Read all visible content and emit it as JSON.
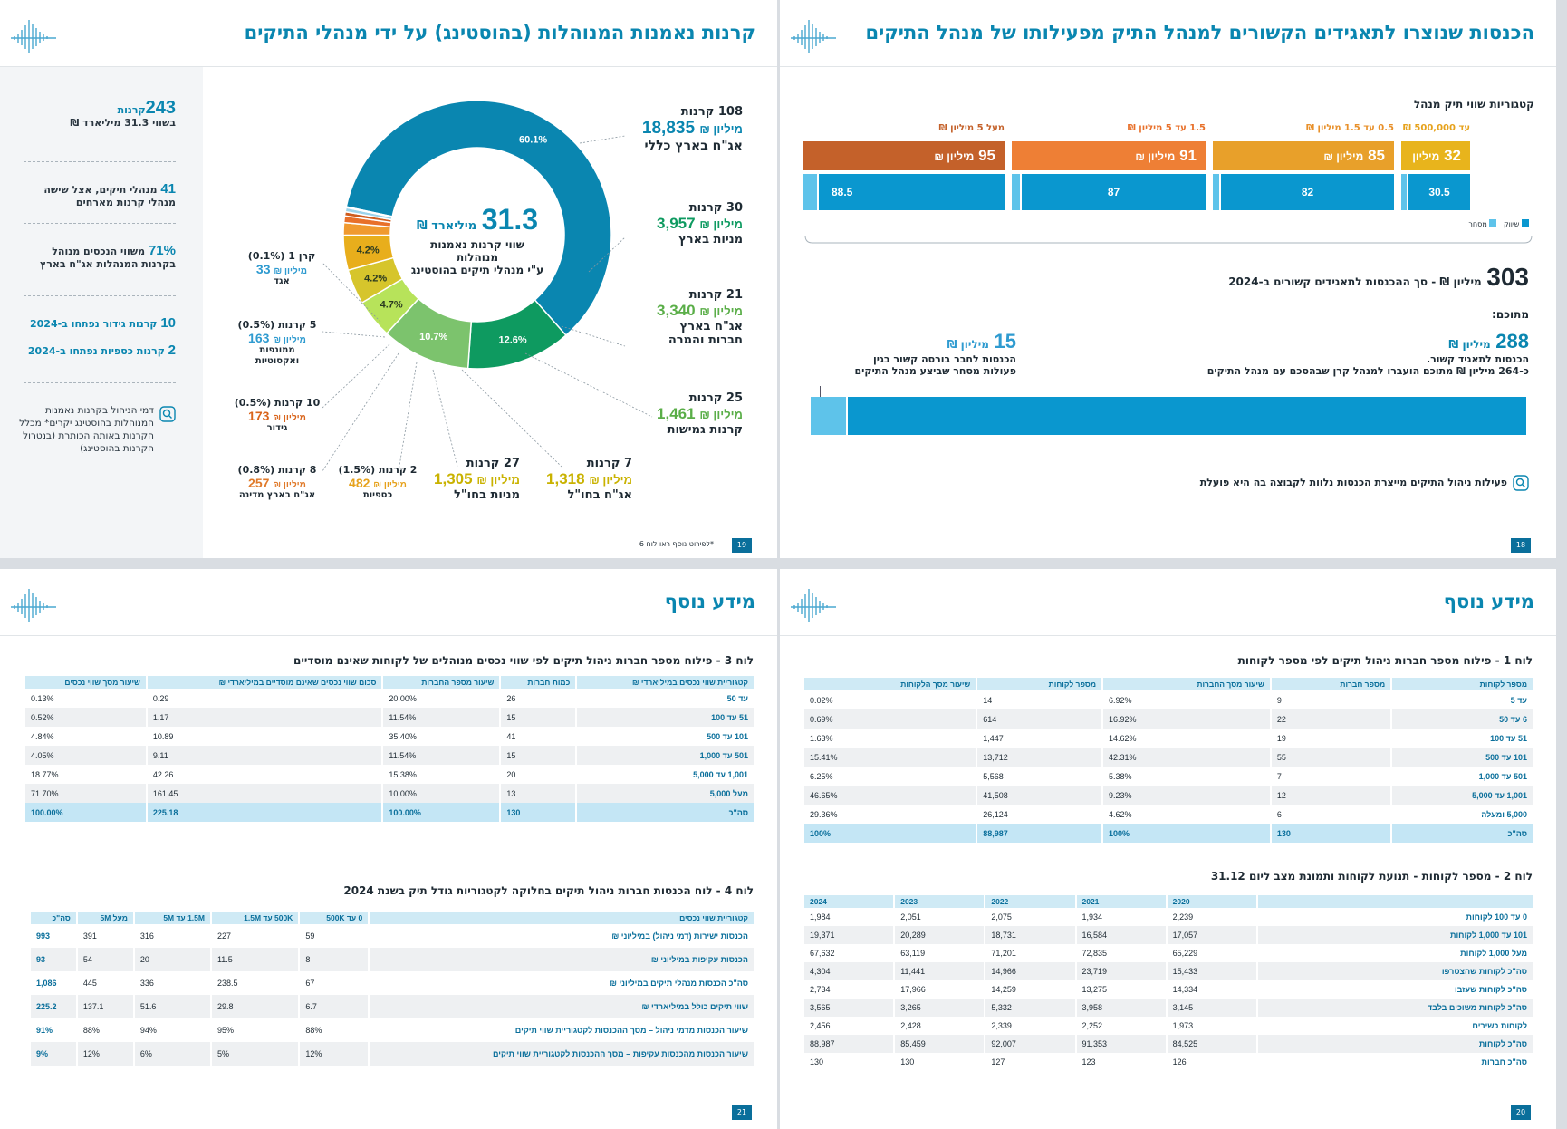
{
  "p19": {
    "title": "קרנות נאמנות המנוהלות (בהוסטינג) על ידי מנהלי התיקים",
    "page_num": "19",
    "footnote": "*לפירוט נוסף ראו לוח 6",
    "sidebar": {
      "funds_num": "243",
      "funds_unit": "קרנות",
      "funds_value": "בשווי 31.3 מיליארד ₪",
      "managers_num": "41",
      "managers_text": "מנהלי תיקים, אצל שישה מנהלי קרנות מארחים",
      "pct_num": "71%",
      "pct_text": "משווי הנכסים מנוהל בקרנות המנהלות אג\"ח בארץ",
      "hedge_num": "10",
      "hedge_text": "קרנות גידור נפתחו ב-2024",
      "money_num": "2",
      "money_text": "קרנות כספיות נפתחו ב-2024",
      "fees_text": "דמי הניהול בקרנות נאמנות המנוהלות בהוסטינג יקרים* מכלל הקרנות באותה הכותרת (בנטרול הקרנות בהוסטינג)"
    },
    "center": {
      "value": "31.3",
      "unit": "מיליארד ₪",
      "line1": "שווי קרנות נאמנות מנוהלות",
      "line2": "ע\"י מנהלי תיקים בהוסטינג"
    },
    "categories": [
      {
        "funds": "108 קרנות",
        "value": "18,835",
        "unit": "מיליון ₪",
        "name": "אג\"ח בארץ כללי",
        "color": "#0a86b0"
      },
      {
        "funds": "30 קרנות",
        "value": "3,957",
        "unit": "מיליון ₪",
        "name": "מניות בארץ",
        "color": "#0e9a60"
      },
      {
        "funds": "21 קרנות",
        "value": "3,340",
        "unit": "מיליון ₪",
        "name": "אג\"ח בארץ",
        "name2": "חברות והמרה",
        "color": "#6bbf59"
      },
      {
        "funds": "25 קרנות",
        "value": "1,461",
        "unit": "מיליון ₪",
        "name": "קרנות גמישות",
        "color": "#6bbf59"
      },
      {
        "funds": "7 קרנות",
        "value": "1,318",
        "unit": "מיליון ₪",
        "name": "אג\"ח בחו\"ל",
        "color": "#c9b200"
      },
      {
        "funds": "27 קרנות",
        "value": "1,305",
        "unit": "מיליון ₪",
        "name": "מניות בחו\"ל",
        "color": "#c9b200"
      },
      {
        "funds": "2 קרנות (1.5%)",
        "value": "482",
        "unit": "מיליון ₪",
        "name": "כספיות",
        "color": "#e6a21c"
      },
      {
        "funds": "8 קרנות (0.8%)",
        "value": "257",
        "unit": "מיליון ₪",
        "name": "אג\"ח בארץ מדינה",
        "color": "#e07a2a"
      },
      {
        "funds": "10 קרנות (0.5%)",
        "value": "173",
        "unit": "מיליון ₪",
        "name": "גידור",
        "color": "#d9651c"
      },
      {
        "funds": "5 קרנות (0.5%)",
        "value": "163",
        "unit": "מיליון ₪",
        "name": "ממונפות",
        "name2": "ואקסוטיות",
        "color": "#5ec3ea"
      },
      {
        "funds": "קרן 1 (0.1%)",
        "value": "33",
        "unit": "מיליון ₪",
        "name": "אגד",
        "color": "#5ec3ea"
      }
    ],
    "chart_data": {
      "type": "pie",
      "title": "",
      "categories": [
        "אג\"ח בארץ כללי",
        "מניות בארץ",
        "אג\"ח בארץ חברות והמרה",
        "קרנות גמישות",
        "אג\"ח בחו\"ל",
        "מניות בחו\"ל",
        "כספיות",
        "אג\"ח בארץ מדינה",
        "גידור",
        "ממונפות ואקסוטיות",
        "אגד"
      ],
      "values": [
        60.1,
        12.6,
        10.7,
        4.7,
        4.2,
        4.2,
        1.5,
        0.8,
        0.5,
        0.5,
        0.1
      ],
      "labels": [
        "60.1%",
        "12.6%",
        "10.7%",
        "4.7%",
        "4.2%",
        "4.2%",
        "",
        "",
        "",
        "",
        ""
      ],
      "colors": [
        "#0a86b0",
        "#0e9a60",
        "#7cc36d",
        "#b7e35a",
        "#d6c52c",
        "#e8ae1c",
        "#f09a2f",
        "#e8702a",
        "#cf5c1e",
        "#9dd3ea",
        "#2f9bd0"
      ]
    }
  },
  "p18": {
    "title": "הכנסות שנוצרו לתאגידים הקשורים למנהל התיק מפעילותו של מנהל התיקים",
    "page_num": "18",
    "categories_label": "קטגוריות שווי תיק מנהל",
    "groups": [
      {
        "label": "עד 500,000 ₪",
        "top": "32",
        "unit": "מיליון ₪",
        "bottom": "30.5",
        "color": "#e8b41c",
        "labelColor": "#e6a21c"
      },
      {
        "label": "0.5 עד 1.5 מיליון ₪",
        "top": "85",
        "unit": "מיליון ₪",
        "bottom": "82",
        "color": "#e8a02a",
        "labelColor": "#e8902a"
      },
      {
        "label": "1.5 עד 5 מיליון ₪",
        "top": "91",
        "unit": "מיליון ₪",
        "bottom": "87",
        "color": "#ee7f35",
        "labelColor": "#e8702a"
      },
      {
        "label": "מעל 5 מיליון ₪",
        "top": "95",
        "unit": "מיליון ₪",
        "bottom": "88.5",
        "color": "#c4612a",
        "labelColor": "#c4612a"
      }
    ],
    "legend": {
      "market": "שיווק",
      "trade": "מסחר"
    },
    "total_num": "303",
    "total_text": "מיליון ₪ - סך ההכנסות לתאגידים קשורים ב-2024",
    "of_which": "מתוכם:",
    "right_num": "288",
    "right_unit": "מיליון ₪",
    "right_line1": "הכנסות לתאגיד קשור.",
    "right_line2": "כ-264 מיליון ₪ מתוכם הועברו למנהל קרן שבהסכם עם מנהל התיקים",
    "left_num": "15",
    "left_unit": "מיליון ₪",
    "left_line1": "הכנסות לחבר בורסה קשור בגין",
    "left_line2": "פעולות מסחר שביצע מנהל התיקים",
    "note": "פעילות ניהול התיקים מייצרת הכנסות נלוות לקבוצה בה היא פועלת",
    "chart_data": {
      "type": "bar",
      "title": "",
      "categories": [
        "עד 500,000 ₪",
        "0.5 עד 1.5 מיליון ₪",
        "1.5 עד 5 מיליון ₪",
        "מעל 5 מיליון ₪"
      ],
      "series": [
        {
          "name": "שיווק",
          "values": [
            30.5,
            82,
            87,
            88.5
          ]
        },
        {
          "name": "מסחר",
          "values": [
            1.5,
            3,
            4,
            6.5
          ]
        }
      ],
      "totals": [
        32,
        85,
        91,
        95
      ],
      "summary": {
        "total": 303,
        "marketing": 288,
        "trading": 15
      }
    }
  },
  "p21": {
    "title": "מידע נוסף",
    "page_num": "21",
    "t3_title": "לוח 3 - פילוח מספר חברות ניהול תיקים לפי שווי נכסים מנוהלים של לקוחות שאינם מוסדיים",
    "t3_headers": [
      "קטגוריית שווי נכסים במיליארדי ₪",
      "כמות חברות",
      "שיעור מספר החברות",
      "סכום שווי נכסים שאינם מוסדיים במיליארדי ₪",
      "שיעור מסך שווי נכסים"
    ],
    "t3_rows": [
      [
        "עד 50",
        "26",
        "20.00%",
        "0.29",
        "0.13%"
      ],
      [
        "51 עד 100",
        "15",
        "11.54%",
        "1.17",
        "0.52%"
      ],
      [
        "101 עד 500",
        "41",
        "35.40%",
        "10.89",
        "4.84%"
      ],
      [
        "501 עד 1,000",
        "15",
        "11.54%",
        "9.11",
        "4.05%"
      ],
      [
        "1,001 עד 5,000",
        "20",
        "15.38%",
        "42.26",
        "18.77%"
      ],
      [
        "מעל 5,000",
        "13",
        "10.00%",
        "161.45",
        "71.70%"
      ],
      [
        "סה\"כ",
        "130",
        "100.00%",
        "225.18",
        "100.00%"
      ]
    ],
    "t4_title": "לוח 4 - לוח הכנסות חברות ניהול תיקים בחלוקה לקטגוריות גודל תיק בשנת 2024",
    "t4_headers": [
      "קטגוריית שווי נכסים",
      "0 עד 500K",
      "500K עד 1.5M",
      "1.5M עד 5M",
      "מעל 5M",
      "סה\"כ"
    ],
    "t4_rows": [
      [
        "הכנסות ישירות (דמי ניהול) במיליוני ₪",
        "59",
        "227",
        "316",
        "391",
        "993"
      ],
      [
        "הכנסות עקיפות במיליוני ₪",
        "8",
        "11.5",
        "20",
        "54",
        "93"
      ],
      [
        "סה\"כ הכנסות מנהלי תיקים במיליוני ₪",
        "67",
        "238.5",
        "336",
        "445",
        "1,086"
      ],
      [
        "שווי תיקים כולל במיליארדי ₪",
        "6.7",
        "29.8",
        "51.6",
        "137.1",
        "225.2"
      ],
      [
        "שיעור הכנסות מדמי ניהול – מסך ההכנסות לקטגוריית שווי תיקים",
        "88%",
        "95%",
        "94%",
        "88%",
        "91%"
      ],
      [
        "שיעור הכנסות מהכנסות עקיפות – מסך ההכנסות לקטגוריית שווי תיקים",
        "12%",
        "5%",
        "6%",
        "12%",
        "9%"
      ]
    ]
  },
  "p20": {
    "title": "מידע נוסף",
    "page_num": "20",
    "t1_title": "לוח 1 - פילוח מספר חברות ניהול תיקים לפי מספר לקוחות",
    "t1_headers": [
      "מספר לקוחות",
      "מספר חברות",
      "שיעור מסך החברות",
      "מספר לקוחות",
      "שיעור מסך הלקוחות"
    ],
    "t1_rows": [
      [
        "עד 5",
        "9",
        "6.92%",
        "14",
        "0.02%"
      ],
      [
        "6 עד 50",
        "22",
        "16.92%",
        "614",
        "0.69%"
      ],
      [
        "51 עד 100",
        "19",
        "14.62%",
        "1,447",
        "1.63%"
      ],
      [
        "101 עד 500",
        "55",
        "42.31%",
        "13,712",
        "15.41%"
      ],
      [
        "501 עד 1,000",
        "7",
        "5.38%",
        "5,568",
        "6.25%"
      ],
      [
        "1,001 עד 5,000",
        "12",
        "9.23%",
        "41,508",
        "46.65%"
      ],
      [
        "5,000 ומעלה",
        "6",
        "4.62%",
        "26,124",
        "29.36%"
      ],
      [
        "סה\"כ",
        "130",
        "100%",
        "88,987",
        "100%"
      ]
    ],
    "t2_title": "לוח 2 - מספר לקוחות - תנועת לקוחות ותמונת מצב ליום 31.12",
    "t2_headers": [
      "",
      "2020",
      "2021",
      "2022",
      "2023",
      "2024"
    ],
    "t2_rows": [
      [
        "0 עד 100 לקוחות",
        "2,239",
        "1,934",
        "2,075",
        "2,051",
        "1,984"
      ],
      [
        "101 עד 1,000 לקוחות",
        "17,057",
        "16,584",
        "18,731",
        "20,289",
        "19,371"
      ],
      [
        "מעל 1,000 לקוחות",
        "65,229",
        "72,835",
        "71,201",
        "63,119",
        "67,632"
      ],
      [
        "סה\"כ לקוחות שהצטרפו",
        "15,433",
        "23,719",
        "14,966",
        "11,441",
        "4,304"
      ],
      [
        "סה\"כ לקוחות שעזבו",
        "14,334",
        "13,275",
        "14,259",
        "17,966",
        "2,734"
      ],
      [
        "סה\"כ לקוחות משוכים בלבד",
        "3,145",
        "3,958",
        "5,332",
        "3,265",
        "3,565"
      ],
      [
        "לקוחות כשירים",
        "1,973",
        "2,252",
        "2,339",
        "2,428",
        "2,456"
      ],
      [
        "סה\"כ לקוחות",
        "84,525",
        "91,353",
        "92,007",
        "85,459",
        "88,987"
      ],
      [
        "סה\"כ חברות",
        "126",
        "123",
        "127",
        "130",
        "130"
      ]
    ]
  }
}
